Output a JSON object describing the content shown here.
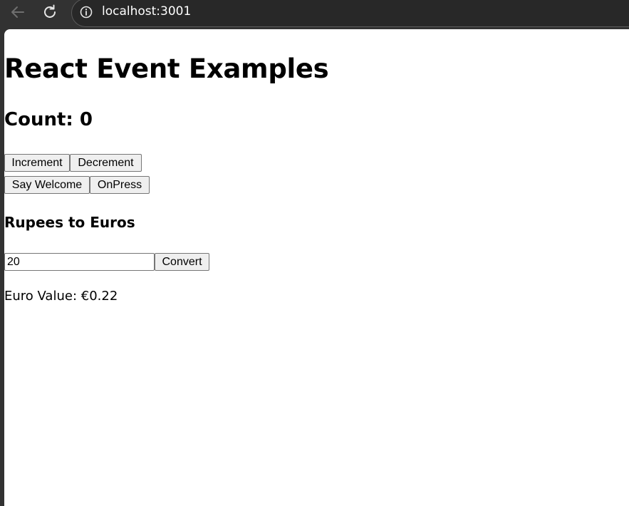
{
  "browser": {
    "url": "localhost:3001"
  },
  "page": {
    "title": "React Event Examples",
    "count_label": "Count: 0",
    "buttons": {
      "increment": "Increment",
      "decrement": "Decrement",
      "say_welcome": "Say Welcome",
      "onpress": "OnPress"
    },
    "converter": {
      "heading": "Rupees to Euros",
      "input_value": "20",
      "convert_label": "Convert",
      "result": "Euro Value: €0.22"
    }
  },
  "icons": [
    "back-arrow-icon",
    "reload-icon",
    "info-icon"
  ],
  "colors": {
    "browser_chrome": "#323232",
    "page_background": "#ffffff",
    "button_background": "#efefef"
  }
}
